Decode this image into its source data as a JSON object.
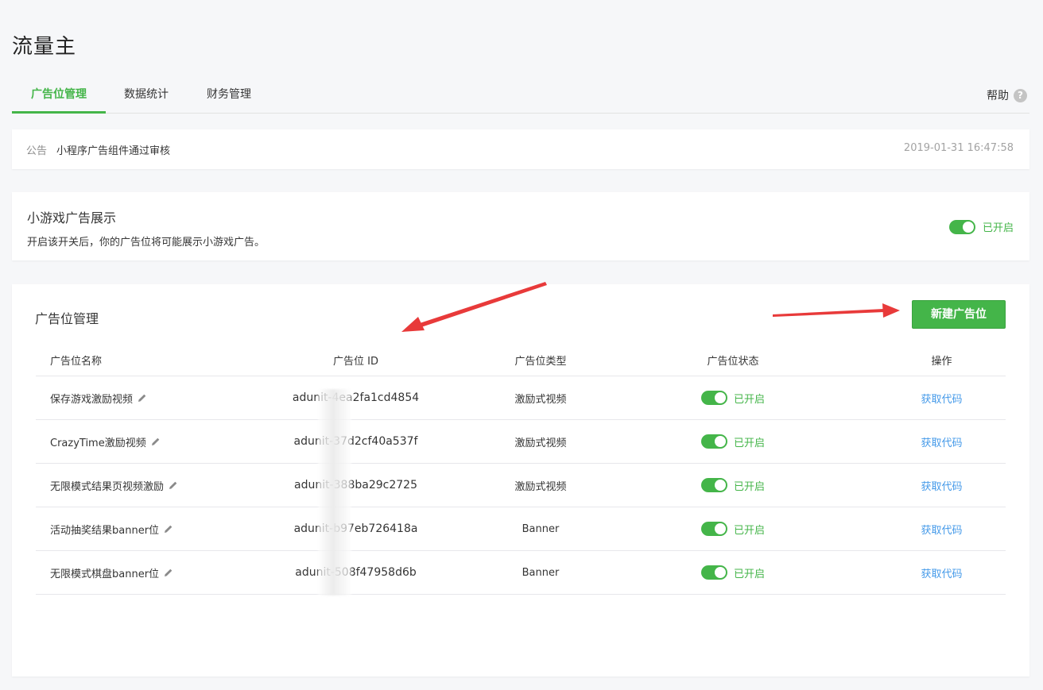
{
  "app": {
    "title": "流量主"
  },
  "tabs": [
    {
      "label": "广告位管理",
      "active": true
    },
    {
      "label": "数据统计",
      "active": false
    },
    {
      "label": "财务管理",
      "active": false
    }
  ],
  "help": {
    "label": "帮助",
    "icon": "question-circle-icon"
  },
  "notice": {
    "label": "公告",
    "text": "小程序广告组件通过审核",
    "time": "2019-01-31 16:47:58"
  },
  "game_ads": {
    "title": "小游戏广告展示",
    "description": "开启该开关后，你的广告位将可能展示小游戏广告。",
    "status": "已开启"
  },
  "ad_management": {
    "title": "广告位管理",
    "new_button": "新建广告位",
    "columns": [
      "广告位名称",
      "广告位 ID",
      "广告位类型",
      "广告位状态",
      "操作"
    ],
    "rows": [
      {
        "name": "保存游戏激励视频",
        "id": "adunit-4ea2fa1cd4854",
        "type": "激励式视频",
        "status": "已开启",
        "action": "获取代码"
      },
      {
        "name": "CrazyTime激励视频",
        "id": "adunit-37d2cf40a537f",
        "type": "激励式视频",
        "status": "已开启",
        "action": "获取代码"
      },
      {
        "name": "无限模式结果页视频激励",
        "id": "adunit-388ba29c2725",
        "type": "激励式视频",
        "status": "已开启",
        "action": "获取代码"
      },
      {
        "name": "活动抽奖结果banner位",
        "id": "adunit-b97eb726418a",
        "type": "Banner",
        "status": "已开启",
        "action": "获取代码"
      },
      {
        "name": "无限模式棋盘banner位",
        "id": "adunit-508f47958d6b",
        "type": "Banner",
        "status": "已开启",
        "action": "获取代码"
      }
    ]
  },
  "colors": {
    "accent": "#44b549",
    "link": "#459ae9",
    "arrow": "#e83a3a"
  }
}
